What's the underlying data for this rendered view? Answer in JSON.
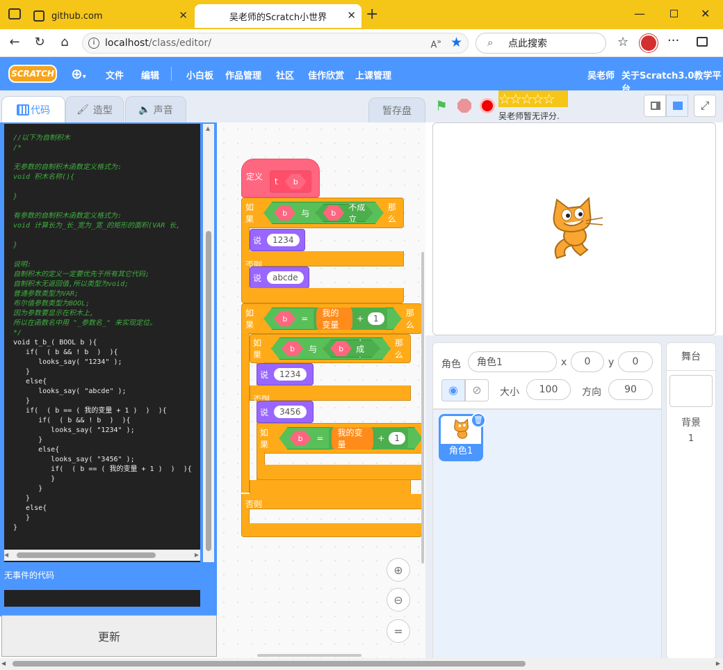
{
  "browser": {
    "tabs": [
      {
        "label": "github.com"
      },
      {
        "label": "吴老师的Scratch小世界"
      }
    ],
    "url": {
      "host": "localhost",
      "path": "/class/editor/"
    },
    "search_placeholder": "点此搜索"
  },
  "header": {
    "logo": "SCRATCH",
    "menu": [
      "文件",
      "编辑",
      "小白板",
      "作品管理",
      "社区",
      "佳作欣赏",
      "上课管理"
    ],
    "user": "吴老师",
    "about": "关于Scratch3.0教学平台"
  },
  "left_tabs": {
    "code": "代码",
    "costume": "造型",
    "sound": "声音",
    "backpack": "暂存盘"
  },
  "code_lines": [
    {
      "t": "//以下为自制积木",
      "c": "cm"
    },
    {
      "t": "/*",
      "c": "cm"
    },
    {
      "t": "",
      "c": "cm"
    },
    {
      "t": "无参数的自制积木函数定义格式为:",
      "c": "cm"
    },
    {
      "t": "void 积木名称(){",
      "c": "cm"
    },
    {
      "t": "",
      "c": "cm"
    },
    {
      "t": "}",
      "c": "cm"
    },
    {
      "t": "",
      "c": "cm"
    },
    {
      "t": "有参数的自制积木函数定义格式为:",
      "c": "cm"
    },
    {
      "t": "void 计算长为_长_宽为_宽_的矩形的面积(VAR 长,",
      "c": "cm"
    },
    {
      "t": "",
      "c": "cm"
    },
    {
      "t": "}",
      "c": "cm"
    },
    {
      "t": "",
      "c": "cm"
    },
    {
      "t": "说明:",
      "c": "cm"
    },
    {
      "t": "自制积木的定义一定要优先于所有其它代码;",
      "c": "cm"
    },
    {
      "t": "自制积木无返回值,所以类型为void;",
      "c": "cm"
    },
    {
      "t": "普通参数类型为VAR;",
      "c": "cm"
    },
    {
      "t": "布尔值参数类型为BOOL;",
      "c": "cm"
    },
    {
      "t": "因为参数要显示在积木上,",
      "c": "cm"
    },
    {
      "t": "所以在函数名中用 \"_参数名_\" 来实现定位。",
      "c": "cm"
    },
    {
      "t": "*/",
      "c": "cm"
    },
    {
      "t": "void t_b_( BOOL b ){",
      "c": "cw"
    },
    {
      "t": "   if(  ( b && ! b  )  ){",
      "c": "cw"
    },
    {
      "t": "      looks_say( \"1234\" );",
      "c": "cw"
    },
    {
      "t": "   }",
      "c": "cw"
    },
    {
      "t": "   else{",
      "c": "cw"
    },
    {
      "t": "      looks_say( \"abcde\" );",
      "c": "cw"
    },
    {
      "t": "   }",
      "c": "cw"
    },
    {
      "t": "   if(  ( b == ( 我的变量 + 1 )  )  ){",
      "c": "cw"
    },
    {
      "t": "      if(  ( b && ! b  )  ){",
      "c": "cw"
    },
    {
      "t": "         looks_say( \"1234\" );",
      "c": "cw"
    },
    {
      "t": "      }",
      "c": "cw"
    },
    {
      "t": "      else{",
      "c": "cw"
    },
    {
      "t": "         looks_say( \"3456\" );",
      "c": "cw"
    },
    {
      "t": "         if(  ( b == ( 我的变量 + 1 )  )  ){",
      "c": "cw"
    },
    {
      "t": "         }",
      "c": "cw"
    },
    {
      "t": "      }",
      "c": "cw"
    },
    {
      "t": "   }",
      "c": "cw"
    },
    {
      "t": "   else{",
      "c": "cw"
    },
    {
      "t": "   }",
      "c": "cw"
    },
    {
      "t": "}",
      "c": "cw"
    }
  ],
  "no_event_label": "无事件的代码",
  "update_button": "更新",
  "blocks": {
    "define": "定义",
    "define_name": "t",
    "param_b": "b",
    "if": "如果",
    "and": "与",
    "not": "不成立",
    "then": "那么",
    "say": "说",
    "else": "否则",
    "eq": "=",
    "plus": "+",
    "var": "我的变量",
    "say_values": [
      "1234",
      "abcde",
      "1234",
      "3456"
    ],
    "num_1": "1"
  },
  "stage": {
    "rating_stars": "☆☆☆☆☆",
    "rating_text": "吴老师暂无评分."
  },
  "sprite": {
    "label": "角色",
    "name": "角色1",
    "x_label": "x",
    "x": "0",
    "y_label": "y",
    "y": "0",
    "size_label": "大小",
    "size": "100",
    "dir_label": "方向",
    "dir": "90",
    "thumb_name": "角色1"
  },
  "stage_panel": {
    "title": "舞台",
    "backdrop_label": "背景",
    "backdrop_count": "1"
  },
  "colors": {
    "accent": "#4c97ff",
    "tabstrip": "#f5c518",
    "control": "#ffab19",
    "operator": "#59c059",
    "looks": "#9966ff"
  }
}
